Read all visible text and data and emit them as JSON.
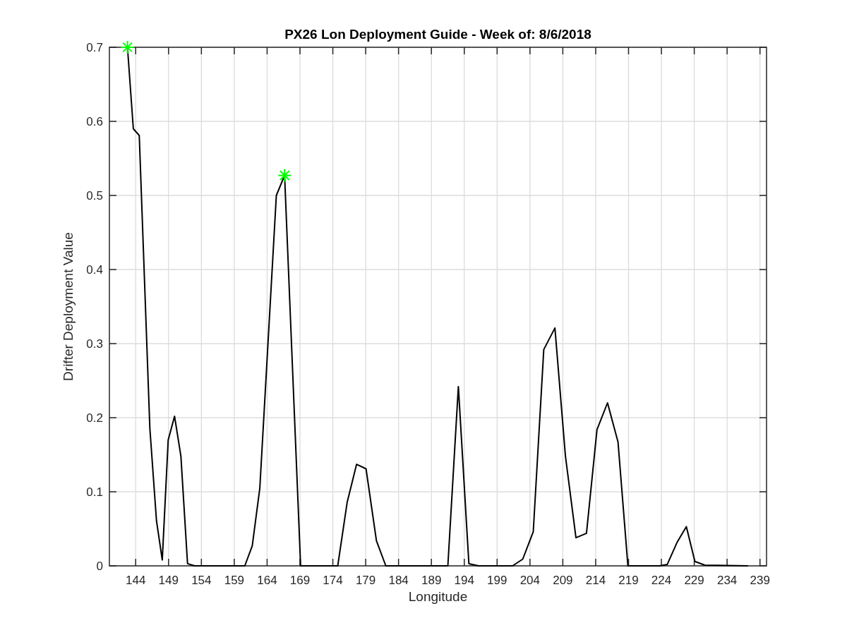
{
  "chart_data": {
    "type": "line",
    "title": "PX26 Lon Deployment Guide - Week of: 8/6/2018",
    "xlabel": "Longitude",
    "ylabel": "Drifter Deployment Value",
    "x": [
      142.75,
      143.64,
      144.54,
      146.15,
      147.16,
      148.05,
      148.95,
      149.91,
      150.88,
      151.89,
      152.97,
      160.6,
      161.74,
      162.89,
      165.4,
      166.66,
      169.1,
      174.75,
      176.19,
      177.62,
      179.05,
      180.63,
      182.06,
      191.5,
      193.1,
      194.7,
      196.2,
      201.35,
      202.9,
      204.5,
      206.1,
      207.8,
      209.4,
      211.0,
      212.6,
      214.2,
      215.8,
      217.4,
      218.9,
      223.7,
      224.9,
      226.4,
      227.8,
      229.1,
      230.6,
      237.2
    ],
    "series": [
      {
        "color": "#000000",
        "values": [
          0.7,
          0.59,
          0.581,
          0.186,
          0.061,
          0.008,
          0.17,
          0.202,
          0.148,
          0.003,
          0,
          0,
          0.027,
          0.105,
          0.5,
          0.527,
          0,
          0,
          0.086,
          0.137,
          0.131,
          0.034,
          0,
          0,
          0.242,
          0.003,
          0,
          0,
          0.009,
          0.046,
          0.292,
          0.321,
          0.148,
          0.038,
          0.044,
          0.184,
          0.22,
          0.167,
          0,
          0,
          0.002,
          0.032,
          0.053,
          0.006,
          0.001,
          0
        ]
      },
      {
        "marker": "cross",
        "color": "#00ff00",
        "values": [
          0.7,
          null,
          null,
          null,
          null,
          null,
          null,
          null,
          null,
          null,
          null,
          null,
          null,
          null,
          null,
          0.527,
          null,
          null,
          null,
          null,
          null,
          null,
          null,
          null,
          null,
          null,
          null,
          null,
          null,
          null,
          null,
          null,
          null,
          null,
          null,
          null,
          null,
          null,
          null,
          null,
          null,
          null,
          null,
          null,
          null,
          null
        ]
      }
    ],
    "grid": true,
    "xlim": [
      140,
      240
    ],
    "ylim": [
      0,
      0.7
    ],
    "xticks": [
      144,
      149,
      154,
      159,
      164,
      169,
      174,
      179,
      184,
      189,
      194,
      199,
      204,
      209,
      214,
      219,
      224,
      229,
      234,
      239
    ],
    "yticks": [
      0,
      0.1,
      0.2,
      0.3,
      0.4,
      0.5,
      0.6,
      0.7
    ]
  }
}
